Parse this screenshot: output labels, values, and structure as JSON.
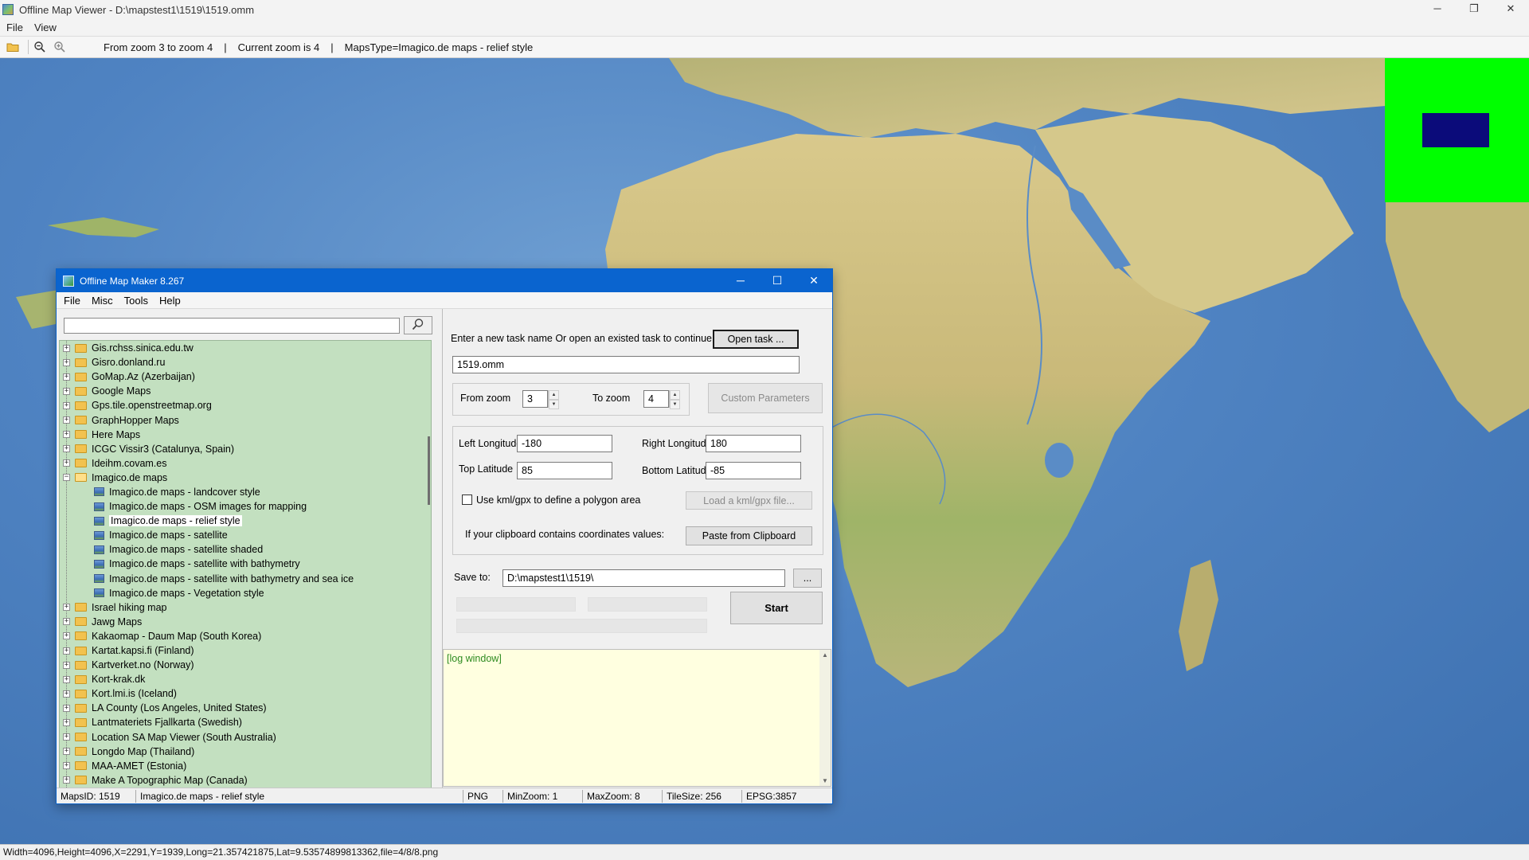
{
  "window": {
    "title": "Offline Map Viewer - D:\\mapstest1\\1519\\1519.omm",
    "controls": {
      "minimize": "─",
      "maximize": "❐",
      "close": "✕"
    }
  },
  "menu": {
    "file": "File",
    "view": "View"
  },
  "toolbar": {
    "status_zoom_range": "From zoom 3 to zoom 4",
    "status_current_zoom": "Current zoom is 4",
    "status_maps_type": "MapsType=Imagico.de maps - relief style",
    "icons": [
      "open-folder-icon",
      "zoom-out-icon",
      "zoom-in-icon"
    ]
  },
  "statusbar": {
    "text": "Width=4096,Height=4096,X=2291,Y=1939,Long=21.357421875,Lat=9.53574899813362,file=4/8/8.png"
  },
  "colors": {
    "ocean": "#4f83c2",
    "land": "#c9b979",
    "overview_bg": "#00ff00",
    "overview_viewport": "#0b0b7a",
    "tree_bg": "#c3e0c0",
    "log_bg": "#ffffe0",
    "dialog_title_bg": "#0a64cf"
  },
  "dialog": {
    "title": "Offline Map Maker 8.267",
    "controls": {
      "minimize": "─",
      "maximize": "☐",
      "close": "✕"
    },
    "menu": {
      "file": "File",
      "misc": "Misc",
      "tools": "Tools",
      "help": "Help"
    },
    "search": {
      "value": "",
      "placeholder": ""
    },
    "tree": [
      {
        "label": "Gis.rchss.sinica.edu.tw",
        "type": "folder",
        "expanded": false
      },
      {
        "label": "Gisro.donland.ru",
        "type": "folder",
        "expanded": false
      },
      {
        "label": "GoMap.Az (Azerbaijan)",
        "type": "folder",
        "expanded": false
      },
      {
        "label": "Google Maps",
        "type": "folder",
        "expanded": false
      },
      {
        "label": "Gps.tile.openstreetmap.org",
        "type": "folder",
        "expanded": false
      },
      {
        "label": "GraphHopper Maps",
        "type": "folder",
        "expanded": false
      },
      {
        "label": "Here Maps",
        "type": "folder",
        "expanded": false
      },
      {
        "label": "ICGC Vissir3 (Catalunya, Spain)",
        "type": "folder",
        "expanded": false
      },
      {
        "label": "Ideihm.covam.es",
        "type": "folder",
        "expanded": false
      },
      {
        "label": "Imagico.de maps",
        "type": "folder",
        "expanded": true
      },
      {
        "label": "Imagico.de maps - landcover style",
        "type": "map"
      },
      {
        "label": "Imagico.de maps - OSM images for mapping",
        "type": "map"
      },
      {
        "label": "Imagico.de maps - relief style",
        "type": "map",
        "selected": true
      },
      {
        "label": "Imagico.de maps - satellite",
        "type": "map"
      },
      {
        "label": "Imagico.de maps - satellite shaded",
        "type": "map"
      },
      {
        "label": "Imagico.de maps - satellite with bathymetry",
        "type": "map"
      },
      {
        "label": "Imagico.de maps - satellite with bathymetry and sea ice",
        "type": "map"
      },
      {
        "label": "Imagico.de maps - Vegetation style",
        "type": "map"
      },
      {
        "label": "Israel hiking map",
        "type": "folder",
        "expanded": false
      },
      {
        "label": "Jawg Maps",
        "type": "folder",
        "expanded": false
      },
      {
        "label": "Kakaomap - Daum Map (South Korea)",
        "type": "folder",
        "expanded": false
      },
      {
        "label": "Kartat.kapsi.fi (Finland)",
        "type": "folder",
        "expanded": false
      },
      {
        "label": "Kartverket.no (Norway)",
        "type": "folder",
        "expanded": false
      },
      {
        "label": "Kort-krak.dk",
        "type": "folder",
        "expanded": false
      },
      {
        "label": "Kort.lmi.is (Iceland)",
        "type": "folder",
        "expanded": false
      },
      {
        "label": "LA County (Los Angeles, United States)",
        "type": "folder",
        "expanded": false
      },
      {
        "label": "Lantmateriets Fjallkarta (Swedish)",
        "type": "folder",
        "expanded": false
      },
      {
        "label": "Location SA Map Viewer (South Australia)",
        "type": "folder",
        "expanded": false
      },
      {
        "label": "Longdo Map (Thailand)",
        "type": "folder",
        "expanded": false
      },
      {
        "label": "MAA-AMET (Estonia)",
        "type": "folder",
        "expanded": false
      },
      {
        "label": "Make A Topographic Map (Canada)",
        "type": "folder",
        "expanded": false
      }
    ],
    "task": {
      "prompt": "Enter a new task name Or open an existed task to continue:",
      "open_button": "Open task ...",
      "name_value": "1519.omm"
    },
    "zoom": {
      "from_label": "From zoom",
      "from_value": "3",
      "to_label": "To zoom",
      "to_value": "4",
      "custom_button": "Custom Parameters"
    },
    "bounds": {
      "left_lon_label": "Left Longitude",
      "left_lon_value": "-180",
      "right_lon_label": "Right Longitude",
      "right_lon_value": "180",
      "top_lat_label": "Top Latitude",
      "top_lat_value": "85",
      "bottom_lat_label": "Bottom Latitude",
      "bottom_lat_value": "-85",
      "kml_checkbox_label": "Use kml/gpx to define a polygon area",
      "kml_checked": false,
      "kml_button": "Load a kml/gpx file...",
      "clipboard_label": "If your clipboard contains coordinates values:",
      "clipboard_button": "Paste from Clipboard"
    },
    "save": {
      "label": "Save to:",
      "path_value": "D:\\mapstest1\\1519\\",
      "browse_button": "...",
      "start_button": "Start"
    },
    "progress": {
      "bar1": 0,
      "bar2": 0,
      "bar3": 0
    },
    "log": {
      "text": "[log window]"
    },
    "status": {
      "maps_id": "MapsID: 1519",
      "maps_name": "Imagico.de maps - relief style",
      "format": "PNG",
      "min_zoom": "MinZoom: 1",
      "max_zoom": "MaxZoom: 8",
      "tile_size": "TileSize: 256",
      "epsg": "EPSG:3857"
    }
  }
}
